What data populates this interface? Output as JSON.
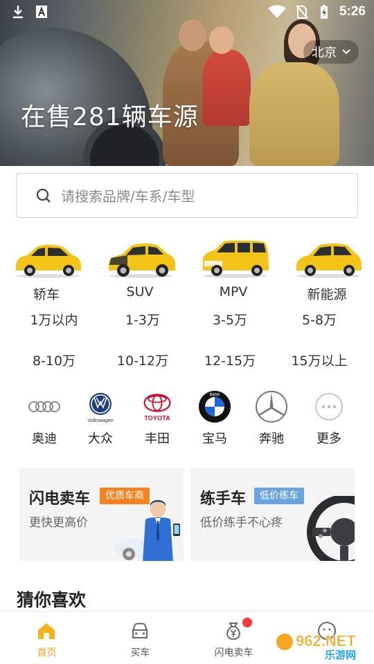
{
  "status_bar": {
    "time": "5:26"
  },
  "hero": {
    "city": "北京",
    "headline": "在售281辆车源"
  },
  "search": {
    "placeholder": "请搜索品牌/车系/车型"
  },
  "car_types": [
    {
      "label": "轿车",
      "color": "#f3c318"
    },
    {
      "label": "SUV",
      "color": "#f3c318"
    },
    {
      "label": "MPV",
      "color": "#f3c318"
    },
    {
      "label": "新能源",
      "color": "#f3c318"
    }
  ],
  "price_ranges_row1": [
    "1万以内",
    "1-3万",
    "3-5万",
    "5-8万"
  ],
  "price_ranges_row2": [
    "8-10万",
    "10-12万",
    "12-15万",
    "15万以上"
  ],
  "brands": [
    {
      "name": "奥迪",
      "icon": "audi-logo"
    },
    {
      "name": "大众",
      "icon": "volkswagen-logo",
      "logo_text": "Volkswagen"
    },
    {
      "name": "丰田",
      "icon": "toyota-logo",
      "logo_text": "TOYOTA"
    },
    {
      "name": "宝马",
      "icon": "bmw-logo",
      "logo_text": "BMW"
    },
    {
      "name": "奔驰",
      "icon": "mercedes-logo"
    },
    {
      "name": "更多",
      "icon": "more-icon"
    }
  ],
  "promos": [
    {
      "title": "闪电卖车",
      "tag": "优质车商",
      "tag_color": "#f5821f",
      "subtitle": "更快更高价"
    },
    {
      "title": "练手车",
      "tag": "低价练车",
      "tag_color": "#6aa4e0",
      "subtitle": "低价练手不心疼"
    }
  ],
  "section_title": "猜你喜欢",
  "bottom_nav": [
    {
      "label": "首页",
      "icon": "home-icon",
      "active": true
    },
    {
      "label": "买车",
      "icon": "car-icon",
      "active": false
    },
    {
      "label": "闪电卖车",
      "icon": "money-bag-icon",
      "active": false,
      "badge": true
    },
    {
      "label": "",
      "icon": "profile-icon",
      "active": false
    }
  ],
  "watermark": {
    "text": "962.NET",
    "subtext": "乐游网"
  },
  "colors": {
    "accent": "#f5a623",
    "badge": "#f23b3b"
  }
}
